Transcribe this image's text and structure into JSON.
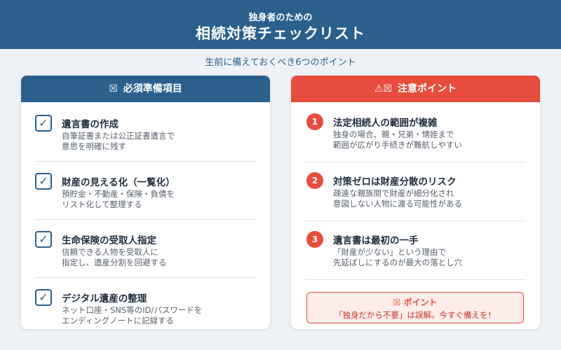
{
  "header": {
    "subtitle": "独身者のための",
    "title": "相続対策チェックリスト"
  },
  "tagline": "生前に備えておくべき6つのポイント",
  "left_panel": {
    "icon": "☒",
    "title": "必須準備項目",
    "items": [
      {
        "check": "✓",
        "title": "遺言書の作成",
        "desc1": "自筆証書または公正証書遺言で",
        "desc2": "意思を明確に残す"
      },
      {
        "check": "✓",
        "title": "財産の見える化（一覧化）",
        "desc1": "預貯金・不動産・保険・負債を",
        "desc2": "リスト化して整理する"
      },
      {
        "check": "✓",
        "title": "生命保険の受取人指定",
        "desc1": "信頼できる人物を受取人に",
        "desc2": "指定し、遺産分割を回避する"
      },
      {
        "check": "✓",
        "title": "デジタル遺産の整理",
        "desc1": "ネット口座・SNS等のID/パスワードを",
        "desc2": "エンディングノートに記録する"
      }
    ]
  },
  "right_panel": {
    "icon": "⚠☒",
    "title": "注意ポイント",
    "items": [
      {
        "num": "1",
        "title": "法定相続人の範囲が複雑",
        "desc1": "独身の場合、親・兄弟・甥姪まで",
        "desc2": "範囲が広がり手続きが難航しやすい"
      },
      {
        "num": "2",
        "title": "対策ゼロは財産分散のリスク",
        "desc1": "疎遠な親族間で財産が細分化され",
        "desc2": "意図しない人物に渡る可能性がある"
      },
      {
        "num": "3",
        "title": "遺言書は最初の一手",
        "desc1": "「財産が少ない」という理由で",
        "desc2": "先延ばしにするのが最大の落とし穴"
      }
    ],
    "point_box": {
      "icon": "☒",
      "title": "ポイント",
      "text": "「独身だから不要」は誤解。今すぐ備えを！"
    }
  },
  "colors": {
    "primary": "#2b5f8c",
    "accent": "#e74c3c",
    "background": "#eef2f6"
  }
}
